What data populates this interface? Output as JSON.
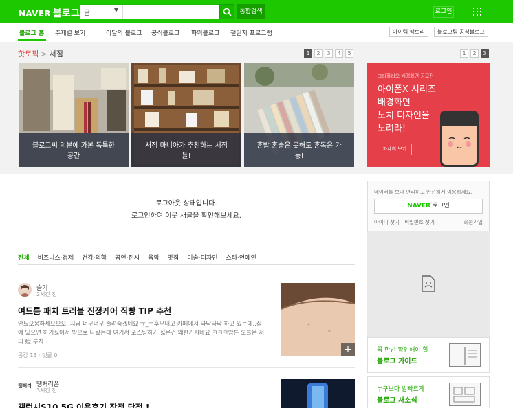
{
  "header": {
    "logo_naver": "NAVER",
    "logo_blog": "블로그",
    "search_select": "글",
    "search_placeholder": "",
    "total_search": "통합검색",
    "login": "로그인"
  },
  "subnav": {
    "items": [
      "블로그 홈",
      "주제별 보기",
      "이달의 블로그",
      "공식블로그",
      "파워블로그",
      "챌린지 프로그램"
    ],
    "buttons": [
      "아이템 팩토리",
      "블로그팀 공식블로그"
    ]
  },
  "hot": {
    "title": "핫토픽",
    "subtitle": "서점",
    "pages": [
      "1",
      "2",
      "3",
      "4",
      "5"
    ],
    "ad_pages": [
      "1",
      "2",
      "3"
    ],
    "cards": [
      {
        "caption": "블로그씨 덕분에 가본 독특한 공간"
      },
      {
        "caption": "서점 마니아가 추천하는 서점들!"
      },
      {
        "caption": "혼밥 혼술은 못해도 혼독은 가능!"
      }
    ]
  },
  "ad": {
    "small": "그라폴리오 배경화면 공모전",
    "line1": "아이폰X 시리즈",
    "line2": "배경화면",
    "line3": "노치 디자인을",
    "line4": "노려라!",
    "button": "자세히 보기"
  },
  "logout": {
    "line1": "로그아웃 상태입니다.",
    "line2": "로그인하여 이웃 새글을 확인해보세요."
  },
  "categories": [
    "전체",
    "비즈니스·경제",
    "건강·의학",
    "공연·전시",
    "음악",
    "맛집",
    "미술·디자인",
    "스타·연예인"
  ],
  "posts": [
    {
      "author": "슬기",
      "time": "2시간 전",
      "title": "여드름 패치 트러블 진정케어 직빵 TIP 추천",
      "body": "안뇨오옹하세요오오..지금 너무너무 졸려죽겠네요 ㅠ_ㅜ후무내고 카페에서 타닥타닥 하고 있는데..집에 있으면 하기싫어서 밖으로 나왔는데 여기서 포스팅하기 싫은건 왜한가지네요 ㅋㅋㅋ암튼 오늘은 저의 痘 루치 ...",
      "meta": "공감 13 · 댓글 0"
    },
    {
      "author": "떙처리폰",
      "time": "3시간 전",
      "title": "갤럭시S10 5G 이용후기 장점 단점 !",
      "avatar_text": "땡처리"
    }
  ],
  "sidebar": {
    "login_desc": "네이버를 보다 편리하고 안전하게 이용하세요.",
    "naver_login_n": "NAVER",
    "naver_login_label": "로그인",
    "find_id": "아이디 찾기",
    "find_pw": "비밀번호 찾기",
    "join": "회원가입",
    "guide1_l1": "꼭 한번 확인해야 할",
    "guide1_l2": "블로그 가이드",
    "guide2_l1": "누구보다 발빠르게",
    "guide2_l2": "블로그 새소식"
  }
}
